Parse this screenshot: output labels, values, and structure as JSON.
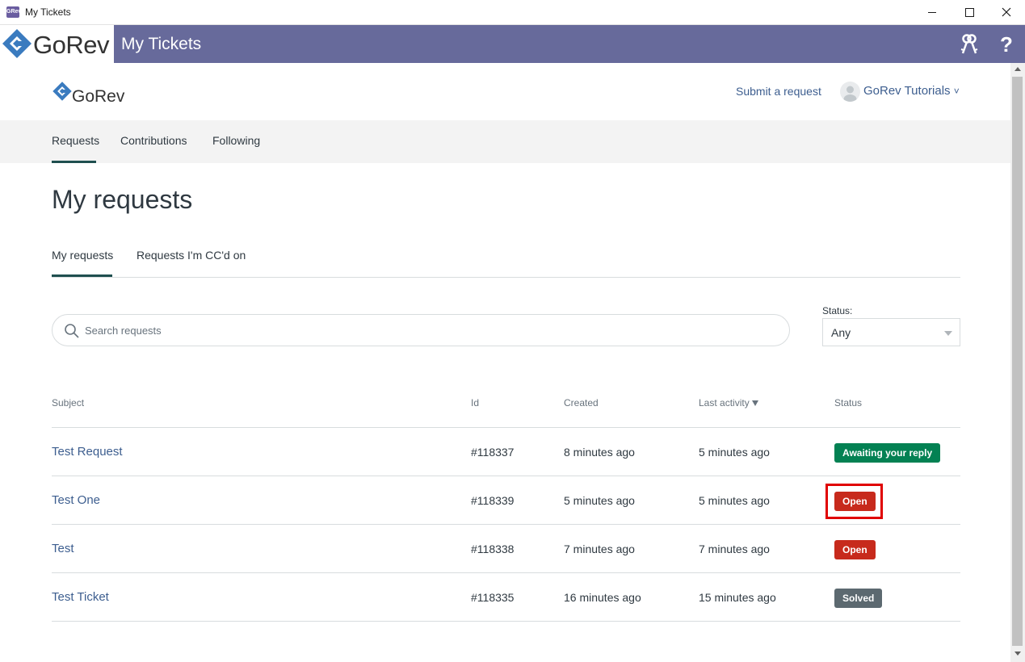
{
  "window": {
    "title": "My Tickets",
    "app_icon_text": "GRev",
    "minimize": "—",
    "maximize": "□",
    "close": "✕"
  },
  "appbar": {
    "logo_text": "GoRev",
    "title": "My Tickets",
    "icons": [
      "keys-icon",
      "help-icon"
    ],
    "help_glyph": "?",
    "bg_color": "#676a9b"
  },
  "portal": {
    "logo_text": "GoRev",
    "submit_link": "Submit a request",
    "user_name": "GoRev Tutorials",
    "user_caret": "˅"
  },
  "subnav": {
    "items": [
      "Requests",
      "Contributions",
      "Following"
    ],
    "active": "Requests"
  },
  "page": {
    "title": "My requests",
    "tabs": [
      "My requests",
      "Requests I'm CC'd on"
    ],
    "active_tab": "My requests"
  },
  "search": {
    "placeholder": "Search requests"
  },
  "status_filter": {
    "label": "Status:",
    "value": "Any"
  },
  "table": {
    "headers": [
      "Subject",
      "Id",
      "Created",
      "Last activity",
      "Status"
    ],
    "sorted_by": "Last activity",
    "rows": [
      {
        "subject": "Test Request",
        "id": "#118337",
        "created": "8 minutes ago",
        "last_activity": "5 minutes ago",
        "status": "Awaiting your reply",
        "status_color": "#038153"
      },
      {
        "subject": "Test One",
        "id": "#118339",
        "created": "5 minutes ago",
        "last_activity": "5 minutes ago",
        "status": "Open",
        "status_color": "#c72a1c",
        "highlighted": true
      },
      {
        "subject": "Test",
        "id": "#118338",
        "created": "7 minutes ago",
        "last_activity": "7 minutes ago",
        "status": "Open",
        "status_color": "#c72a1c"
      },
      {
        "subject": "Test Ticket",
        "id": "#118335",
        "created": "16 minutes ago",
        "last_activity": "15 minutes ago",
        "status": "Solved",
        "status_color": "#5c6970"
      }
    ]
  }
}
